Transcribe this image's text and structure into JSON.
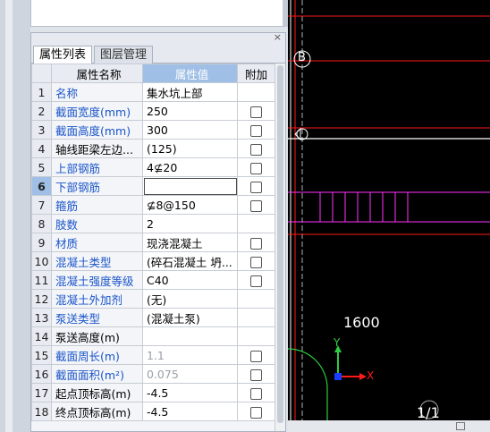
{
  "panel": {
    "tabs": [
      {
        "label": "属性列表",
        "active": true
      },
      {
        "label": "图层管理",
        "active": false
      }
    ],
    "close_icon": "×",
    "headers": {
      "num": "",
      "name": "属性名称",
      "value": "属性值",
      "extra": "附加"
    },
    "rows": [
      {
        "num": "1",
        "name": "名称",
        "value": "集水坑上部",
        "name_color": "blue",
        "checkbox": false
      },
      {
        "num": "2",
        "name": "截面宽度(mm)",
        "value": "250",
        "name_color": "blue",
        "checkbox": true
      },
      {
        "num": "3",
        "name": "截面高度(mm)",
        "value": "300",
        "name_color": "blue",
        "checkbox": true
      },
      {
        "num": "4",
        "name": "轴线距梁左边...",
        "value": "(125)",
        "name_color": "black",
        "checkbox": true
      },
      {
        "num": "5",
        "name": "上部钢筋",
        "value": "4⊈20",
        "name_color": "blue",
        "checkbox": true
      },
      {
        "num": "6",
        "name": "下部钢筋",
        "value": "",
        "name_color": "blue",
        "checkbox": true,
        "current": true
      },
      {
        "num": "7",
        "name": "箍筋",
        "value": "⊈8@150",
        "name_color": "blue",
        "checkbox": true
      },
      {
        "num": "8",
        "name": "肢数",
        "value": "2",
        "name_color": "blue",
        "checkbox": false
      },
      {
        "num": "9",
        "name": "材质",
        "value": "现浇混凝土",
        "name_color": "blue",
        "checkbox": true
      },
      {
        "num": "10",
        "name": "混凝土类型",
        "value": "(碎石混凝土 坍...",
        "name_color": "blue",
        "checkbox": true
      },
      {
        "num": "11",
        "name": "混凝土强度等级",
        "value": "C40",
        "name_color": "blue",
        "checkbox": true
      },
      {
        "num": "12",
        "name": "混凝土外加剂",
        "value": "(无)",
        "name_color": "blue",
        "checkbox": false
      },
      {
        "num": "13",
        "name": "泵送类型",
        "value": "(混凝土泵)",
        "name_color": "blue",
        "checkbox": false
      },
      {
        "num": "14",
        "name": "泵送高度(m)",
        "value": "",
        "name_color": "black",
        "checkbox": false
      },
      {
        "num": "15",
        "name": "截面周长(m)",
        "value": "1.1",
        "name_color": "blue",
        "checkbox": true,
        "value_gray": true
      },
      {
        "num": "16",
        "name": "截面面积(m²)",
        "value": "0.075",
        "name_color": "blue",
        "checkbox": true,
        "value_gray": true
      },
      {
        "num": "17",
        "name": "起点顶标高(m)",
        "value": "-4.5",
        "name_color": "black",
        "checkbox": true
      },
      {
        "num": "18",
        "name": "终点顶标高(m)",
        "value": "-4.5",
        "name_color": "black",
        "checkbox": true
      }
    ]
  },
  "cad": {
    "axis_label_b": "B",
    "dimension": "1600",
    "grid_id": "1/1",
    "ucs_x": "X",
    "ucs_y": "Y",
    "colors": {
      "background": "#000000",
      "red": "#ff1a1a",
      "magenta": "#ff33ff",
      "white": "#ffffff",
      "green": "#2ecc40"
    }
  }
}
